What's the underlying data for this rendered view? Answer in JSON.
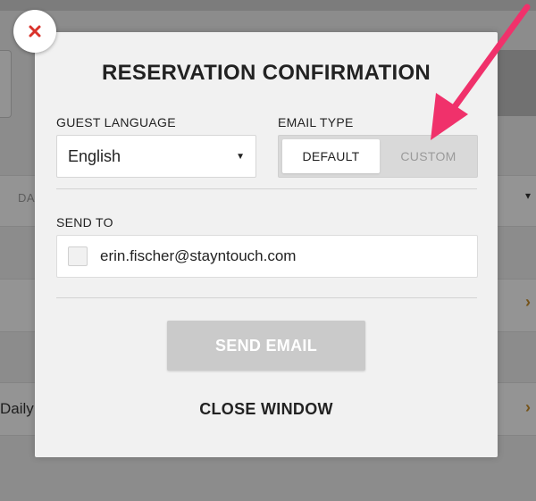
{
  "background": {
    "truncated_column_label": "DA",
    "truncated_row_text": "Daily I"
  },
  "modal": {
    "title": "RESERVATION CONFIRMATION",
    "guest_language": {
      "label": "GUEST LANGUAGE",
      "selected": "English"
    },
    "email_type": {
      "label": "EMAIL TYPE",
      "options": [
        "DEFAULT",
        "CUSTOM"
      ],
      "active": "DEFAULT"
    },
    "send_to": {
      "label": "SEND TO",
      "email": "erin.fischer@stayntouch.com",
      "checked": false
    },
    "send_button_label": "SEND EMAIL",
    "close_window_label": "CLOSE WINDOW"
  },
  "colors": {
    "annotation_arrow": "#f0316b",
    "close_icon": "#d9322b",
    "send_button_disabled": "#cacaca",
    "background_accent_x": "#c48a2a"
  },
  "icons": {
    "close": "close-icon",
    "dropdown": "chevron-down-icon"
  }
}
